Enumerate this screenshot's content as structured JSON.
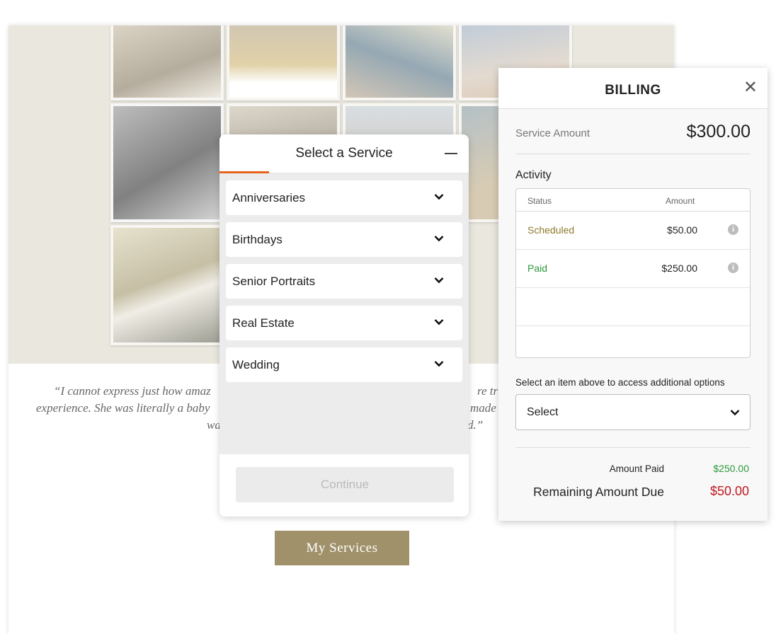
{
  "background_page": {
    "testimonial": {
      "line1": "“I cannot express just how amaz",
      "line1_end": "re truly",
      "line2": "experience. She was literally a baby",
      "line2_end": "made",
      "line3": "wa",
      "line3_end": "d.”"
    },
    "my_services_label": "My Services"
  },
  "service_modal": {
    "title": "Select a Service",
    "items": [
      {
        "label": "Anniversaries"
      },
      {
        "label": "Birthdays"
      },
      {
        "label": "Senior Portraits"
      },
      {
        "label": "Real Estate"
      },
      {
        "label": "Wedding"
      }
    ],
    "continue_label": "Continue",
    "accent_color": "#e8621a"
  },
  "billing": {
    "title": "BILLING",
    "close_icon": "close-icon",
    "service_amount_label": "Service Amount",
    "service_amount_value": "$300.00",
    "activity_label": "Activity",
    "table_headers": {
      "status": "Status",
      "amount": "Amount"
    },
    "rows": [
      {
        "status": "Scheduled",
        "amount": "$50.00",
        "status_color": "#8f7a2a"
      },
      {
        "status": "Paid",
        "amount": "$250.00",
        "status_color": "#2a9a3c"
      }
    ],
    "options_label": "Select an item above to access additional options",
    "select_value": "Select",
    "amount_paid_label": "Amount Paid",
    "amount_paid_value": "$250.00",
    "remaining_label": "Remaining Amount Due",
    "remaining_value": "$50.00"
  }
}
